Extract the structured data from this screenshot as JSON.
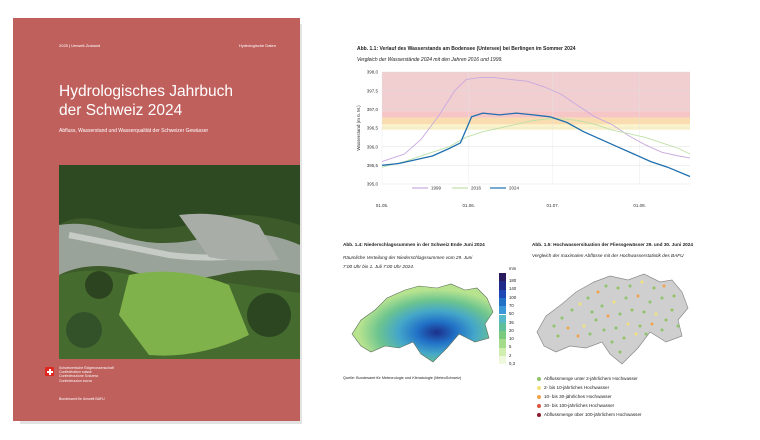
{
  "cover": {
    "series": "2025 | Umwelt-Zustand",
    "category": "Hydrologische Daten",
    "title_line1": "Hydrologisches Jahrbuch",
    "title_line2": "der Schweiz 2024",
    "subtitle": "Abfluss, Wasserstand und Wasserqualität der Schweizer Gewässer",
    "federation": [
      "Schweizerische Eidgenossenschaft",
      "Confédération suisse",
      "Confederazione Svizzera",
      "Confederaziun svizra"
    ],
    "office": "Bundesamt für Umwelt BAFU"
  },
  "fig_1_1": {
    "title": "Abb. 1.1: Verlauf des Wasserstands am Bodensee (Untersee) bei Berlingen im Sommer 2024",
    "subtitle": "Vergleich der Wasserstände 2024 mit den Jahren 2016 und 1999."
  },
  "fig_1_4": {
    "title": "Abb. 1.4: Niederschlagssummen in der Schweiz Ende Juni 2024",
    "subtitle_line1": "Räumliche Verteilung der Niederschlagssummen vom 29. Juni",
    "subtitle_line2": "7:00 Uhr bis 1. Juli 7:00 Uhr 2024.",
    "scale_unit": "mm",
    "scale_values": [
      "180",
      "140",
      "100",
      "70",
      "50",
      "35",
      "20",
      "10",
      "5",
      "2",
      "0,3"
    ],
    "scale_colors": [
      "#2a1a5e",
      "#1f2a8a",
      "#1c47b4",
      "#2171c7",
      "#3a98d8",
      "#55b9c8",
      "#5fbf9a",
      "#7cca80",
      "#a5dc8b",
      "#cfeeb0",
      "#eef8dc"
    ],
    "source": "Quelle: Bundesamt für Meteorologie und Klimatologie (MeteoSchweiz)"
  },
  "fig_1_5": {
    "title": "Abb. 1.5: Hochwassersituation der Fliessgewässer 29. und 30. Juni 2024",
    "subtitle": "Vergleich der maximalen Abflüsse mit der Hochwasserstatistik des BAFU",
    "legend": [
      {
        "label": "Abflussmenge unter 2-jährlichem Hochwasser",
        "color": "#8fc36b"
      },
      {
        "label": "2- bis 10-jährliches Hochwasser",
        "color": "#f3e27a"
      },
      {
        "label": "10- bis 30-jährliches Hochwasser",
        "color": "#f2a24a"
      },
      {
        "label": "30- bis 100-jährliches Hochwasser",
        "color": "#d9553d"
      },
      {
        "label": "Abflussmenge über 100-jährlichem Hochwasser",
        "color": "#8e1b2d"
      }
    ]
  },
  "chart_data": {
    "type": "line",
    "title": "Abb. 1.1: Verlauf des Wasserstands am Bodensee (Untersee) bei Berlingen im Sommer 2024",
    "ylabel": "Wasserstand (m ü. M.)",
    "xlabel": "",
    "ylim": [
      395.0,
      398.0
    ],
    "yticks": [
      "395,0",
      "395,5",
      "396,0",
      "396,5",
      "397,0",
      "397,5",
      "398,0"
    ],
    "xticks": [
      "01.05.",
      "01.06.",
      "01.07.",
      "01.08."
    ],
    "x_days": [
      0,
      31,
      61,
      92
    ],
    "x_max": 110,
    "bands": [
      {
        "from": 396.45,
        "to": 396.6,
        "color": "#fbf3c9"
      },
      {
        "from": 396.6,
        "to": 396.78,
        "color": "#f9dcb0"
      },
      {
        "from": 396.78,
        "to": 396.95,
        "color": "#f6c6c6"
      },
      {
        "from": 396.95,
        "to": 398.0,
        "color": "#f1cfd0"
      }
    ],
    "series": [
      {
        "name": "1999",
        "color": "#c9a9df",
        "x": [
          0,
          8,
          14,
          20,
          26,
          30,
          35,
          40,
          46,
          52,
          58,
          64,
          70,
          76,
          82,
          88,
          94,
          100,
          106,
          110
        ],
        "y": [
          395.6,
          395.8,
          396.2,
          396.8,
          397.5,
          397.8,
          397.85,
          397.85,
          397.8,
          397.75,
          397.6,
          397.4,
          397.1,
          396.8,
          396.6,
          396.3,
          396.05,
          395.85,
          395.75,
          395.7
        ]
      },
      {
        "name": "2016",
        "color": "#bfe0a9",
        "x": [
          0,
          8,
          16,
          24,
          30,
          36,
          42,
          48,
          54,
          60,
          64,
          70,
          76,
          82,
          88,
          94,
          100,
          106,
          110
        ],
        "y": [
          395.45,
          395.6,
          395.8,
          396.0,
          396.25,
          396.4,
          396.5,
          396.6,
          396.7,
          396.75,
          396.75,
          396.7,
          396.6,
          396.45,
          396.35,
          396.25,
          396.1,
          395.95,
          395.8
        ]
      },
      {
        "name": "2024",
        "color": "#1f6fae",
        "x": [
          0,
          6,
          12,
          18,
          24,
          28,
          32,
          36,
          42,
          48,
          54,
          60,
          66,
          72,
          78,
          84,
          90,
          96,
          102,
          110
        ],
        "y": [
          395.5,
          395.55,
          395.65,
          395.75,
          395.95,
          396.1,
          396.8,
          396.9,
          396.85,
          396.9,
          396.85,
          396.8,
          396.65,
          396.4,
          396.2,
          396.0,
          395.8,
          395.6,
          395.45,
          395.2
        ]
      }
    ]
  }
}
